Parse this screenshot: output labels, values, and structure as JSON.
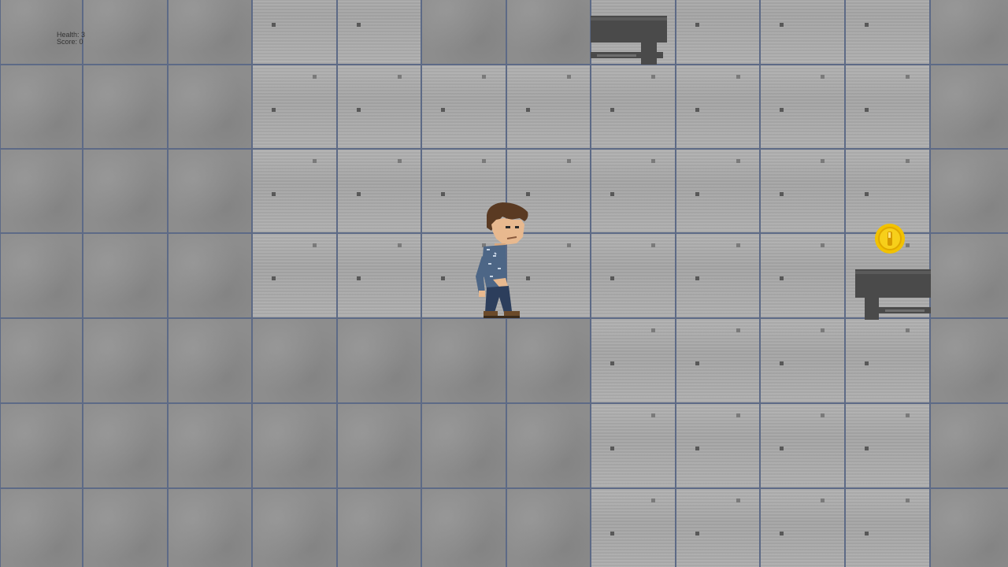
{
  "hud": {
    "health_text": "Health: 3",
    "score_text": "Score: 0",
    "health": 3,
    "score": 0
  },
  "colors": {
    "grid_line": "#5d6a86",
    "wall": "#8d8d8d",
    "background_tile": "#aaaaaa",
    "platform": "#4a4a4a",
    "coin": "#f2c200",
    "coin_inner": "#e0a800",
    "player_hair": "#5a3a22",
    "player_shirt": "#4d6686",
    "player_pants": "#2c3e5c"
  },
  "objects": {
    "player": "player-character",
    "coin": "gold-coin",
    "platforms": [
      "stone-ledge",
      "stone-ledge"
    ]
  }
}
